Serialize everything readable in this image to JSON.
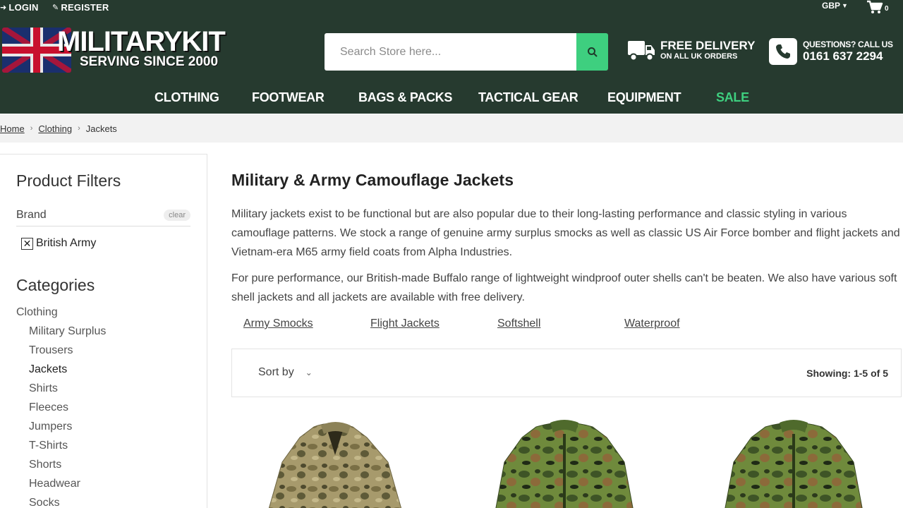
{
  "topbar": {
    "login_label": "LOGIN",
    "register_label": "REGISTER",
    "currency": "GBP",
    "cart_count": "0"
  },
  "logo": {
    "main": "MILITARYKIT",
    "sub": "SERVING SINCE 2000"
  },
  "search": {
    "placeholder": "Search Store here..."
  },
  "delivery": {
    "title": "FREE DELIVERY",
    "subtitle": "ON ALL UK ORDERS"
  },
  "contact": {
    "question": "QUESTIONS? CALL US",
    "phone": "0161 637 2294"
  },
  "nav": {
    "items": [
      "CLOTHING",
      "FOOTWEAR",
      "BAGS & PACKS",
      "TACTICAL GEAR",
      "EQUIPMENT",
      "SALE"
    ]
  },
  "breadcrumb": {
    "items": [
      "Home",
      "Clothing",
      "Jackets"
    ]
  },
  "sidebar": {
    "filters_title": "Product Filters",
    "brand_label": "Brand",
    "clear_label": "clear",
    "active_filter": "British Army",
    "categories_title": "Categories",
    "categories": [
      "Clothing",
      "Military Surplus",
      "Trousers",
      "Jackets",
      "Shirts",
      "Fleeces",
      "Jumpers",
      "T-Shirts",
      "Shorts",
      "Headwear",
      "Socks"
    ]
  },
  "main": {
    "title": "Military & Army Camouflage Jackets",
    "desc1": "Military jackets exist to be functional but are also popular due to their long-lasting performance and classic styling in various camouflage patterns. We stock a range of genuine army surplus smocks as well as classic US Air Force bomber and flight jackets and Vietnam-era M65 army field coats from Alpha Industries.",
    "desc2": "For pure performance, our British-made Buffalo range of lightweight windproof outer shells can't be beaten. We also have various soft shell jackets and all jackets are available with free delivery.",
    "subcategories": [
      "Army Smocks",
      "Flight Jackets",
      "Softshell",
      "Waterproof"
    ],
    "sort_label": "Sort by",
    "showing": "Showing: 1-5 of 5"
  },
  "colors": {
    "header_bg": "#263a2f",
    "accent_green": "#3ecf7f"
  }
}
